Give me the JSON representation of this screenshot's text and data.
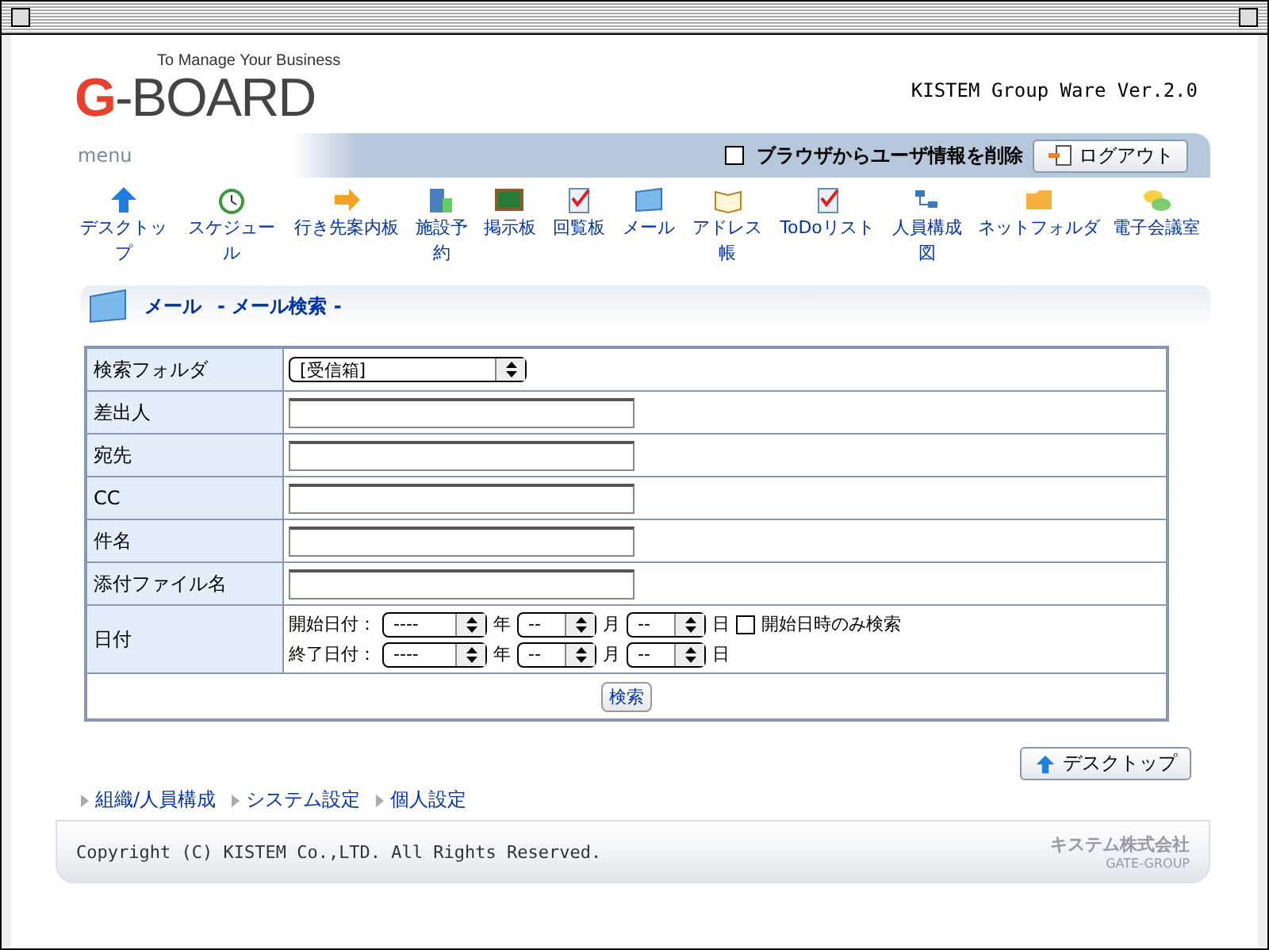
{
  "header": {
    "tagline": "To Manage Your Business",
    "wordmark": "G-BOARD",
    "version": "KISTEM Group Ware Ver.2.0"
  },
  "menu_bar": {
    "label": "menu",
    "clear_user_info": {
      "label": "ブラウザからユーザ情報を削除",
      "checked": false
    },
    "logout": "ログアウト"
  },
  "nav": [
    {
      "label": "デスクトップ"
    },
    {
      "label": "スケジュール"
    },
    {
      "label": "行き先案内板"
    },
    {
      "label": "施設予約"
    },
    {
      "label": "掲示板"
    },
    {
      "label": "回覧板"
    },
    {
      "label": "メール"
    },
    {
      "label": "アドレス帳"
    },
    {
      "label": "ToDoリスト"
    },
    {
      "label": "人員構成図"
    },
    {
      "label": "ネットフォルダ"
    },
    {
      "label": "電子会議室"
    }
  ],
  "page_header": {
    "title": "メール",
    "subtitle": "- メール検索 -"
  },
  "form": {
    "rows": [
      {
        "kind": "select",
        "label": "検索フォルダ",
        "value": "[受信箱]"
      },
      {
        "kind": "text",
        "label": "差出人"
      },
      {
        "kind": "text",
        "label": "宛先"
      },
      {
        "kind": "text",
        "label": "CC"
      },
      {
        "kind": "text",
        "label": "件名"
      },
      {
        "kind": "text",
        "label": "添付ファイル名"
      },
      {
        "kind": "date",
        "label": "日付",
        "lines": [
          {
            "label": "開始日付：",
            "year": "----",
            "year_unit": "年",
            "month": "--",
            "month_unit": "月",
            "day": "--",
            "day_unit": "日",
            "option": {
              "label": "開始日時のみ検索",
              "checked": false
            }
          },
          {
            "label": "終了日付：",
            "year": "----",
            "year_unit": "年",
            "month": "--",
            "month_unit": "月",
            "day": "--",
            "day_unit": "日"
          }
        ]
      }
    ],
    "submit": "検索"
  },
  "desktop_button": "デスクトップ",
  "footer": {
    "links": [
      "組織/人員構成",
      "システム設定",
      "個人設定"
    ],
    "copyright": "Copyright (C) KISTEM Co.,LTD. All Rights Reserved.",
    "company": "キステム株式会社",
    "group": "GATE-GROUP"
  }
}
